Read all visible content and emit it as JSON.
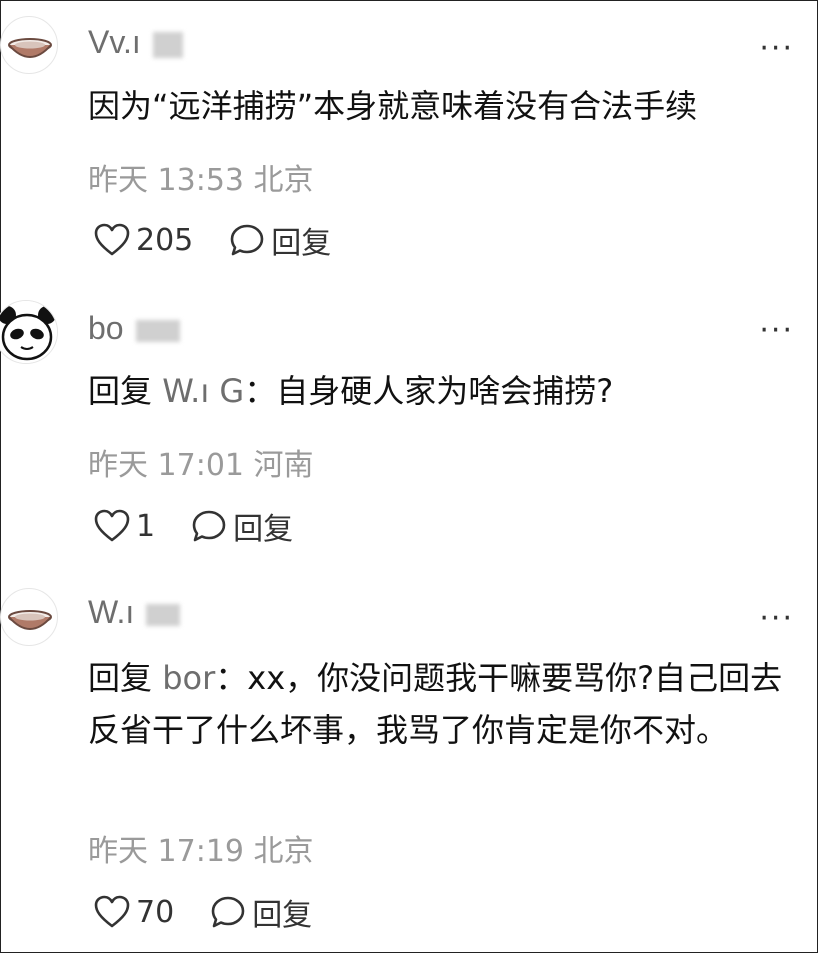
{
  "comments": [
    {
      "avatar": "bowl-avatar",
      "username": "Vv.ı",
      "content": "因为“远洋捕捞”本身就意味着没有合法手续",
      "reply_prefix": "",
      "reply_to": "",
      "reply_sep": "",
      "time": "昨天 13:53 北京",
      "likes": "205",
      "reply_label": "回复"
    },
    {
      "avatar": "panda-avatar",
      "username": "bo",
      "reply_prefix": "回复",
      "reply_to": "W.ı G",
      "reply_sep": "：",
      "content": "自身硬人家为啥会捕捞?",
      "time": "昨天 17:01 河南",
      "likes": "1",
      "reply_label": "回复"
    },
    {
      "avatar": "bowl-avatar",
      "username": "W.ı",
      "reply_prefix": "回复",
      "reply_to": "bor",
      "reply_sep": "：",
      "content": "xx，你没问题我干嘛要骂你?自己回去反省干了什么坏事，我骂了你肯定是你不对。",
      "time": "昨天 17:19 北京",
      "likes": "70",
      "reply_label": "回复"
    }
  ],
  "more_label": "···",
  "colors": {
    "text": "#111111",
    "secondary": "#6e6e6e",
    "meta": "#9a9a9a",
    "bowl": "#b07a68"
  }
}
